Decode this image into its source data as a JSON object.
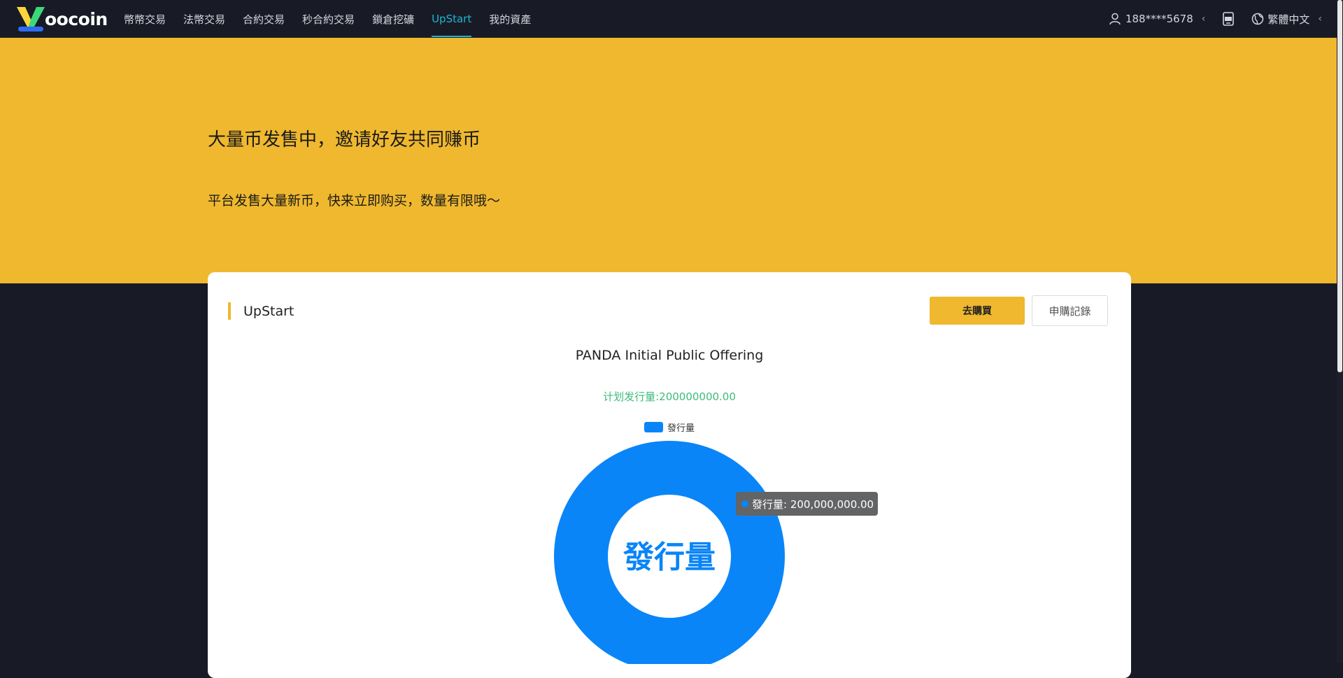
{
  "brand": {
    "logo_text": "oocoin"
  },
  "nav": {
    "items": [
      {
        "label": "幣幣交易",
        "active": false
      },
      {
        "label": "法幣交易",
        "active": false
      },
      {
        "label": "合約交易",
        "active": false
      },
      {
        "label": "秒合約交易",
        "active": false
      },
      {
        "label": "鎖倉挖礦",
        "active": false
      },
      {
        "label": "UpStart",
        "active": true
      },
      {
        "label": "我的資產",
        "active": false
      }
    ],
    "user": "188****5678",
    "language": "繁體中文",
    "chevron": "‹"
  },
  "banner": {
    "title": "大量币发售中，邀请好友共同赚币",
    "subtitle": "平台发售大量新币，快来立即购买，数量有限哦～"
  },
  "card": {
    "title": "UpStart",
    "buy_button": "去購買",
    "record_button": "申購記錄"
  },
  "chart_data": {
    "type": "pie",
    "title": "PANDA Initial Public Offering",
    "subtitle": "计划发行量:200000000.00",
    "legend": [
      "發行量"
    ],
    "center_label": "發行量",
    "series": [
      {
        "name": "發行量",
        "value": 200000000,
        "color": "#0a85f8"
      }
    ],
    "tooltip": "發行量: 200,000,000.00"
  },
  "colors": {
    "accent": "#efb82e",
    "nav_active": "#1fb5d4",
    "chart_blue": "#0a85f8",
    "subtitle_green": "#3dbb7a"
  }
}
